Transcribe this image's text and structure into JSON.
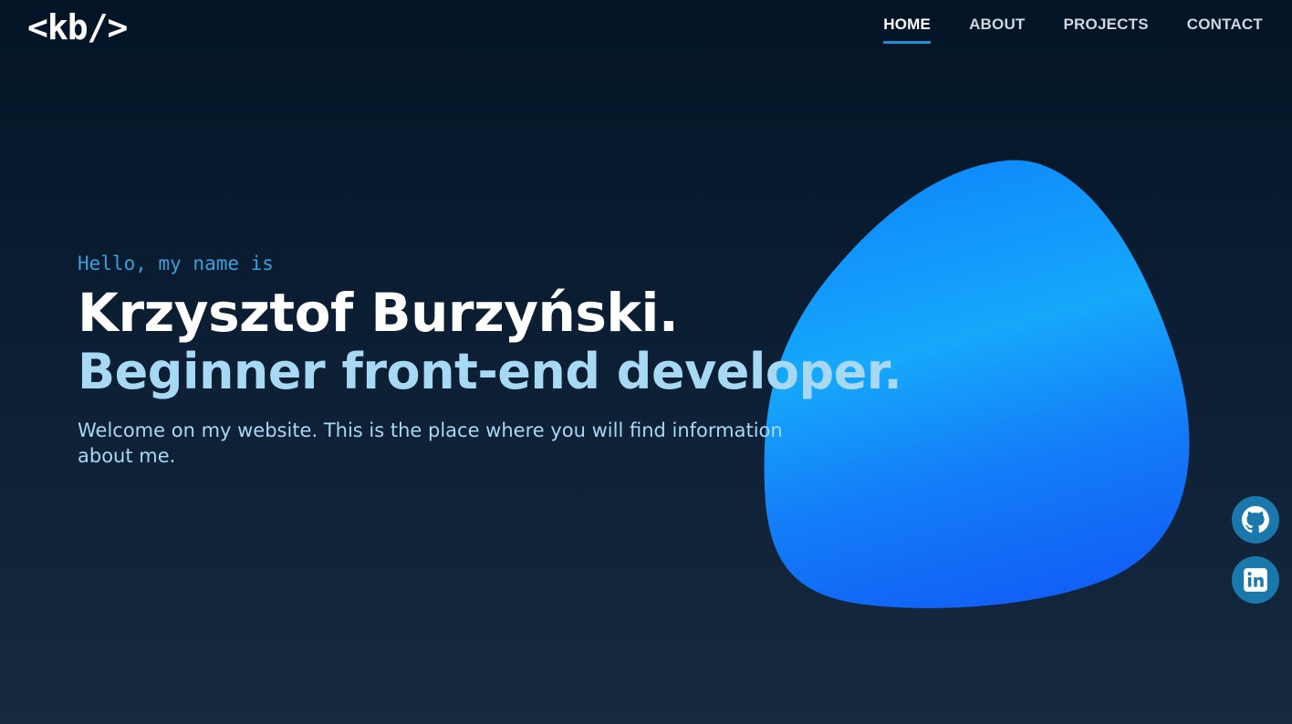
{
  "header": {
    "logo": "<kb/>",
    "nav": [
      {
        "label": "HOME",
        "active": true
      },
      {
        "label": "ABOUT",
        "active": false
      },
      {
        "label": "PROJECTS",
        "active": false
      },
      {
        "label": "CONTACT",
        "active": false
      }
    ]
  },
  "hero": {
    "greeting": "Hello, my name is",
    "name": "Krzysztof Burzyński.",
    "role": "Beginner front-end developer.",
    "intro": "Welcome on my website. This is the place where you will find information about me."
  },
  "social": [
    {
      "icon": "github-icon"
    },
    {
      "icon": "linkedin-icon"
    }
  ],
  "colors": {
    "accent": "#1e8fd8",
    "greeting": "#3aa0db",
    "subtext": "#a7d8f4",
    "blob_top": "#0c8cff",
    "blob_bottom": "#1262f5"
  }
}
